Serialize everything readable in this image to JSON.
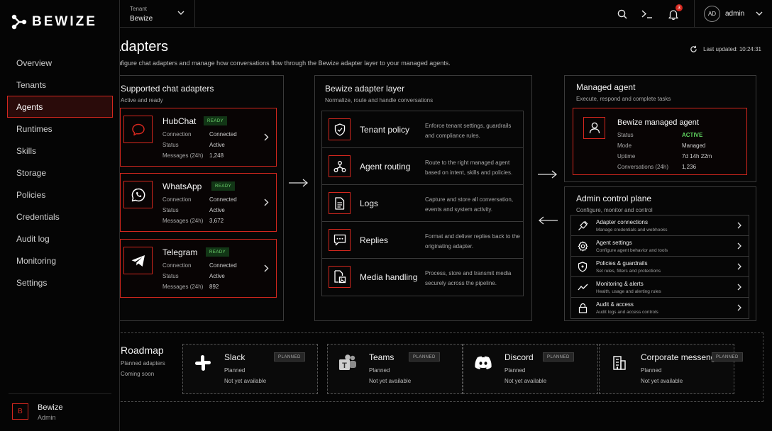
{
  "brand": {
    "name": "BEWIZE",
    "accent": "#d4271e"
  },
  "sidebar": {
    "items": [
      {
        "label": "Overview"
      },
      {
        "label": "Tenants"
      },
      {
        "label": "Agents",
        "active": true
      },
      {
        "label": "Runtimes"
      },
      {
        "label": "Skills"
      },
      {
        "label": "Storage"
      },
      {
        "label": "Policies"
      },
      {
        "label": "Credentials"
      },
      {
        "label": "Audit log"
      },
      {
        "label": "Monitoring"
      },
      {
        "label": "Settings"
      }
    ],
    "user": {
      "initial": "B",
      "name": "Bewize",
      "role": "Admin"
    }
  },
  "header": {
    "tenant_label": "Tenant",
    "tenant_value": "Bewize",
    "notification_count": "3",
    "admin_initials": "AD",
    "admin_name": "admin"
  },
  "page": {
    "title": "Adapters",
    "subtitle": "Configure chat adapters and manage how conversations flow through the Bewize adapter layer to your managed agents.",
    "last_updated": "Last updated: 10:24:31"
  },
  "adapters": {
    "title": "Supported chat adapters",
    "subtitle": "Active and ready",
    "key_labels": {
      "connection": "Connection",
      "status": "Status",
      "messages": "Messages (24h)"
    },
    "items": [
      {
        "name": "HubChat",
        "badge": "READY",
        "connection": "Connected",
        "status": "Active",
        "messages": "1,248",
        "icon": "chat-bubble-icon"
      },
      {
        "name": "WhatsApp",
        "badge": "READY",
        "connection": "Connected",
        "status": "Active",
        "messages": "3,672",
        "icon": "whatsapp-icon"
      },
      {
        "name": "Telegram",
        "badge": "READY",
        "connection": "Connected",
        "status": "Active",
        "messages": "892",
        "icon": "telegram-icon"
      }
    ]
  },
  "layer": {
    "title": "Bewize adapter layer",
    "subtitle": "Normalize, route and handle conversations",
    "items": [
      {
        "name": "Tenant policy",
        "desc": "Enforce tenant settings, guardrails and compliance rules.",
        "icon": "shield-check-icon"
      },
      {
        "name": "Agent routing",
        "desc": "Route to the right managed agent based on intent, skills and policies.",
        "icon": "routing-icon"
      },
      {
        "name": "Logs",
        "desc": "Capture and store all conversation, events and system activity.",
        "icon": "document-icon"
      },
      {
        "name": "Replies",
        "desc": "Format and deliver replies back to the originating adapter.",
        "icon": "message-dots-icon"
      },
      {
        "name": "Media handling",
        "desc": "Process, store and transmit media securely across the pipeline.",
        "icon": "media-file-icon"
      }
    ]
  },
  "managed": {
    "title": "Managed agent",
    "subtitle": "Execute, respond and complete tasks",
    "card": {
      "name": "Bewize managed agent",
      "status_label": "Status",
      "status_value": "ACTIVE",
      "mode_label": "Mode",
      "mode_value": "Managed",
      "uptime_label": "Uptime",
      "uptime_value": "7d 14h 22m",
      "conv_label": "Conversations (24h)",
      "conv_value": "1,236"
    }
  },
  "control": {
    "title": "Admin control plane",
    "subtitle": "Configure, monitor and control",
    "items": [
      {
        "title": "Adapter connections",
        "desc": "Manage credentials and webhooks",
        "icon": "plug-icon"
      },
      {
        "title": "Agent settings",
        "desc": "Configure agent behavior and tools",
        "icon": "gear-icon"
      },
      {
        "title": "Policies & guardrails",
        "desc": "Set rules, filters and protections",
        "icon": "shield-icon"
      },
      {
        "title": "Monitoring & alerts",
        "desc": "Health, usage and alerting rules",
        "icon": "activity-icon"
      },
      {
        "title": "Audit & access",
        "desc": "Audit logs and access controls",
        "icon": "lock-icon"
      }
    ]
  },
  "roadmap": {
    "title": "Roadmap",
    "sub1": "Planned adapters",
    "sub2": "Coming soon",
    "items": [
      {
        "name": "Slack",
        "badge": "PLANNED",
        "status": "Planned",
        "note": "Not yet available",
        "icon": "slack-icon"
      },
      {
        "name": "Teams",
        "badge": "PLANNED",
        "status": "Planned",
        "note": "Not yet available",
        "icon": "teams-icon"
      },
      {
        "name": "Discord",
        "badge": "PLANNED",
        "status": "Planned",
        "note": "Not yet available",
        "icon": "discord-icon"
      },
      {
        "name": "Corporate messenger",
        "badge": "PLANNED",
        "status": "Planned",
        "note": "Not yet available",
        "icon": "building-icon"
      }
    ]
  }
}
